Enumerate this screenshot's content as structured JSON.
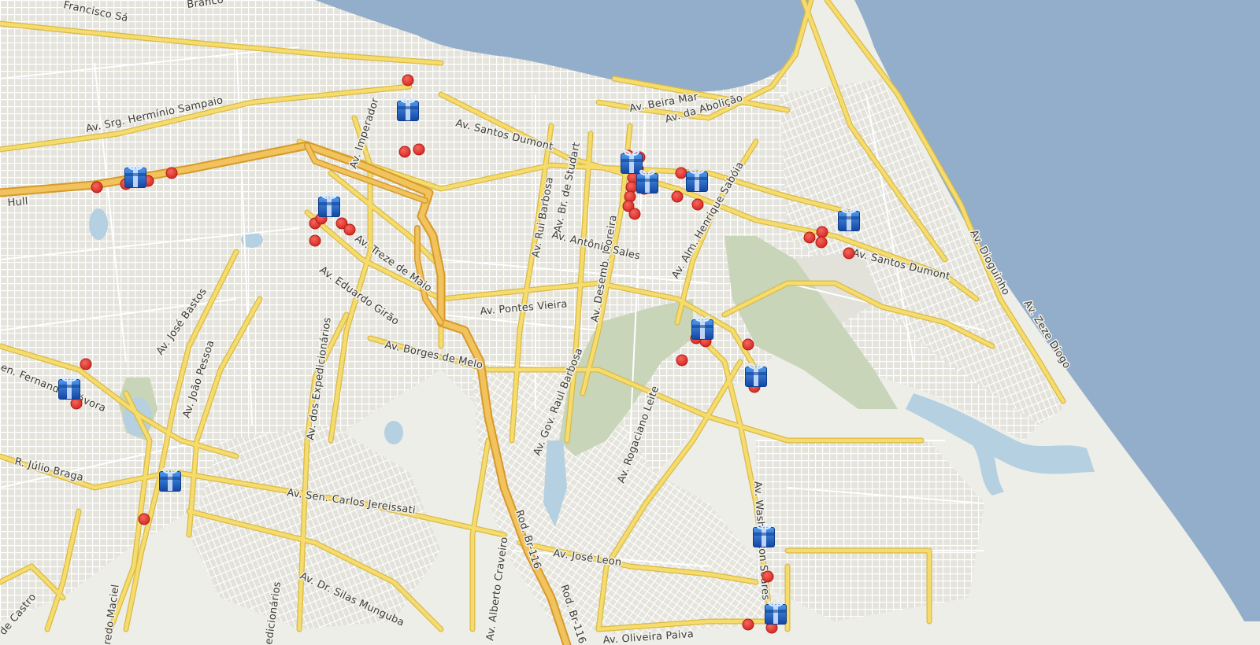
{
  "map": {
    "colors": {
      "water": "#93aecb",
      "land": "#eeeee9",
      "park": "#c8d5b9",
      "lagoon": "#b5d0e0",
      "street": "#ffffff",
      "street_casing": "#cfcfc8",
      "avenue": "#f6dc6c",
      "avenue_casing": "#d8ba48",
      "trunk": "#f2c25c",
      "trunk_casing": "#d59a2a",
      "marker_red": "#e23b35",
      "marker_blue": "#1d66c4"
    },
    "road_labels": [
      "Francisco Sá",
      "Branco",
      "Av. Srg. Hermínio Sampaio",
      "Hull",
      "Av. Imperador",
      "Av. Santos Dumont",
      "Av. Beira Mar",
      "Av. da Abolição",
      "Av. Rui Barbosa",
      "Av. Br. de Studart",
      "Av. Desemb. Moreira",
      "Av. Alm. Henrique Sabóia",
      "Av. Antônio Sales",
      "Av. Treze de Maio",
      "Av. Eduardo Girão",
      "Av. Pontes Vieira",
      "Av. Borges de Melo",
      "Av. José Bastos",
      "Av. João Pessoa",
      "Av. dos Expedicionários",
      "Av. Gov. Raul Barbosa",
      "Av. Rogaciano Leite",
      "Av. Santos Dumont",
      "Av. Dioguinho",
      "Av. Zeze Diogo",
      "en. Fernandes Távora",
      "R. Júlio Braga",
      "Av. Sen. Carlos Jereissati",
      "Av. Washington Soares",
      "Av. José Leon",
      "Av. Dr. Silas Munguba",
      "Av. Alberto Craveiro",
      "Rod. Br-116",
      "Rod. Br-116",
      "Av. Oliveira Paiva",
      "edicionários",
      "redo Maciel",
      "de Castro"
    ],
    "markers": {
      "poi_icon": "gift-box-icon",
      "point_icon": "red-dot-icon",
      "poi_count": 13,
      "point_count": 42
    }
  }
}
